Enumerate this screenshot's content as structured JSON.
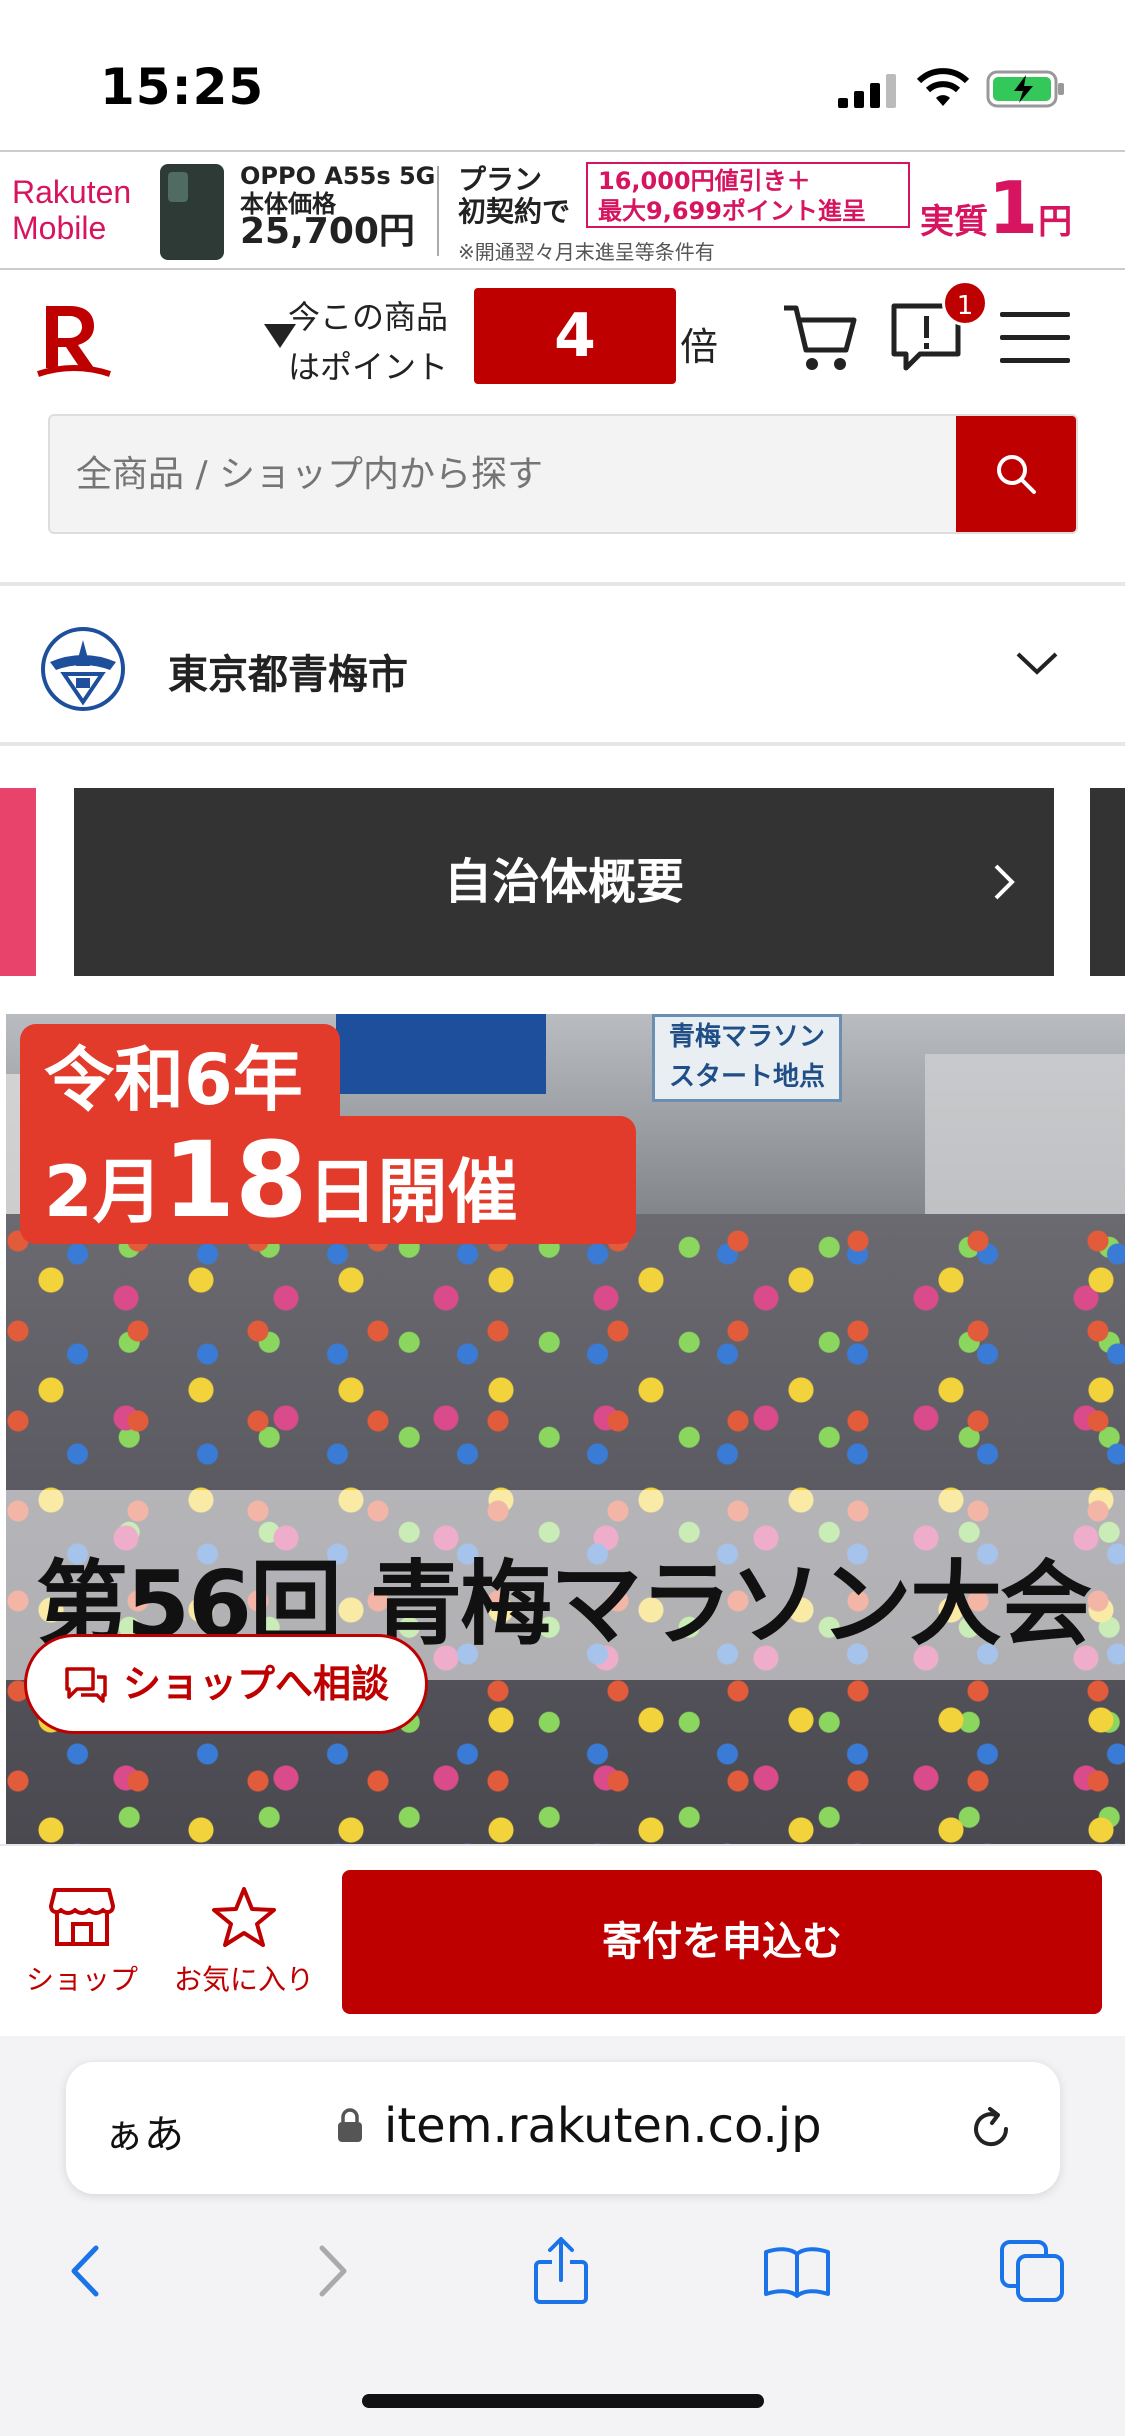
{
  "status_bar": {
    "time": "15:25"
  },
  "ad": {
    "brand_line1": "Rakuten",
    "brand_line2": "Mobile",
    "model": "OPPO A55s 5G",
    "price_label": "本体価格",
    "price": "25,700円",
    "plan_line1": "プラン",
    "plan_line2": "初契約で",
    "offer_line1": "16,000円値引き＋",
    "offer_line2": "最大9,699ポイント進呈",
    "effective": "実質",
    "effective_price": "1",
    "effective_unit": "円",
    "note": "※開通翌々月末進呈等条件有"
  },
  "header": {
    "points_text_1": "今この商品",
    "points_text_2": "はポイント",
    "points_multiplier": "4",
    "points_suffix": "倍",
    "notification_count": "1"
  },
  "search": {
    "placeholder": "全商品 / ショップ内から探す"
  },
  "municipality": {
    "name": "東京都青梅市"
  },
  "carousel": {
    "current_label": "自治体概要"
  },
  "hero": {
    "date_line1": "令和6年",
    "date_month": "2月",
    "date_day": "18",
    "date_suffix": "日開催",
    "start_sign": "青梅マラソン スタート地点",
    "title": "第56回 青梅マラソン大会"
  },
  "consult_button": "ショップへ相談",
  "action_bar": {
    "shop_label": "ショップ",
    "favorite_label": "お気に入り",
    "donate_label": "寄付を申込む"
  },
  "browser": {
    "text_size": "ぁあ",
    "url": "item.rakuten.co.jp"
  },
  "colors": {
    "brand_red": "#bf0000",
    "accent_pink": "#d6145f"
  }
}
